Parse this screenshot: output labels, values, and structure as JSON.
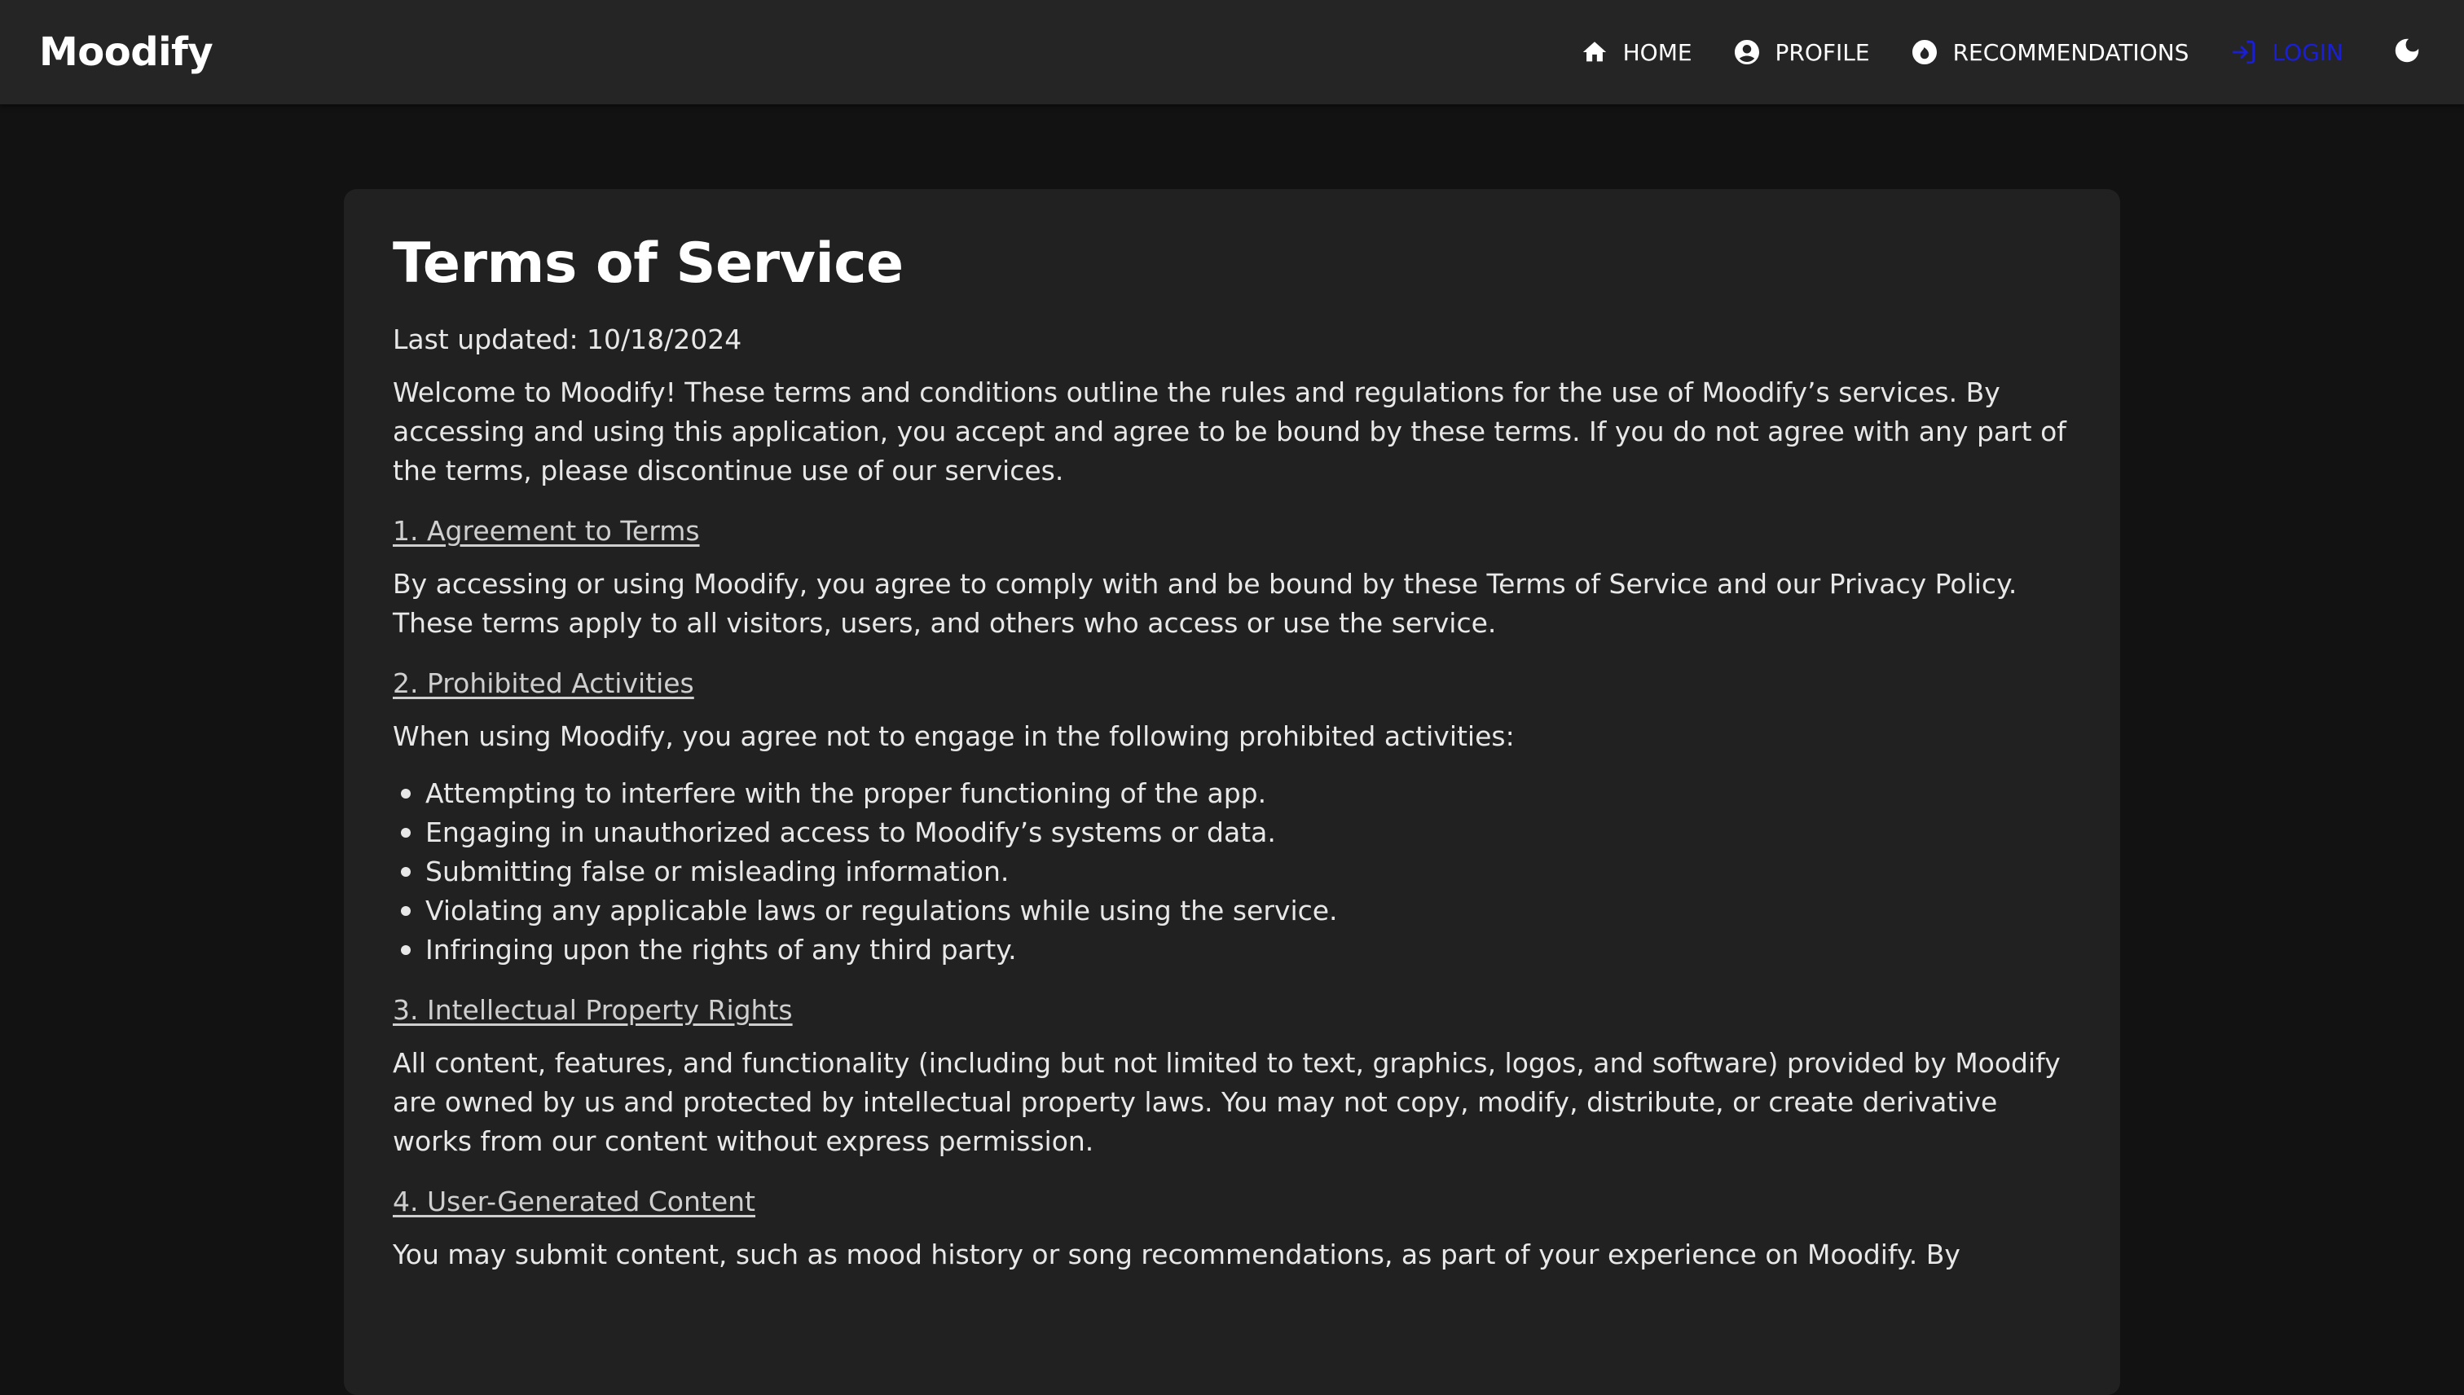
{
  "brand": "Moodify",
  "nav": {
    "home": "HOME",
    "profile": "PROFILE",
    "recommendations": "RECOMMENDATIONS",
    "login": "LOGIN"
  },
  "icons": {
    "home": "home-icon",
    "profile": "account-circle-icon",
    "recommendations": "recommendation-icon",
    "login": "login-icon",
    "theme": "moon-icon"
  },
  "colors": {
    "background": "#121212",
    "navbar": "#252525",
    "card": "#212121",
    "login": "#1a1fd6"
  },
  "page": {
    "title": "Terms of Service",
    "updated": "Last updated: 10/18/2024",
    "intro": "Welcome to Moodify! These terms and conditions outline the rules and regulations for the use of Moodify’s services. By accessing and using this application, you accept and agree to be bound by these terms. If you do not agree with any part of the terms, please discontinue use of our services.",
    "sections": [
      {
        "heading": "1. Agreement to Terms",
        "text": "By accessing or using Moodify, you agree to comply with and be bound by these Terms of Service and our Privacy Policy. These terms apply to all visitors, users, and others who access or use the service."
      },
      {
        "heading": "2. Prohibited Activities",
        "text": "When using Moodify, you agree not to engage in the following prohibited activities:",
        "bullets": [
          "Attempting to interfere with the proper functioning of the app.",
          "Engaging in unauthorized access to Moodify’s systems or data.",
          "Submitting false or misleading information.",
          "Violating any applicable laws or regulations while using the service.",
          "Infringing upon the rights of any third party."
        ]
      },
      {
        "heading": "3. Intellectual Property Rights",
        "text": "All content, features, and functionality (including but not limited to text, graphics, logos, and software) provided by Moodify are owned by us and protected by intellectual property laws. You may not copy, modify, distribute, or create derivative works from our content without express permission."
      },
      {
        "heading": "4. User-Generated Content",
        "text": "You may submit content, such as mood history or song recommendations, as part of your experience on Moodify. By"
      }
    ]
  }
}
